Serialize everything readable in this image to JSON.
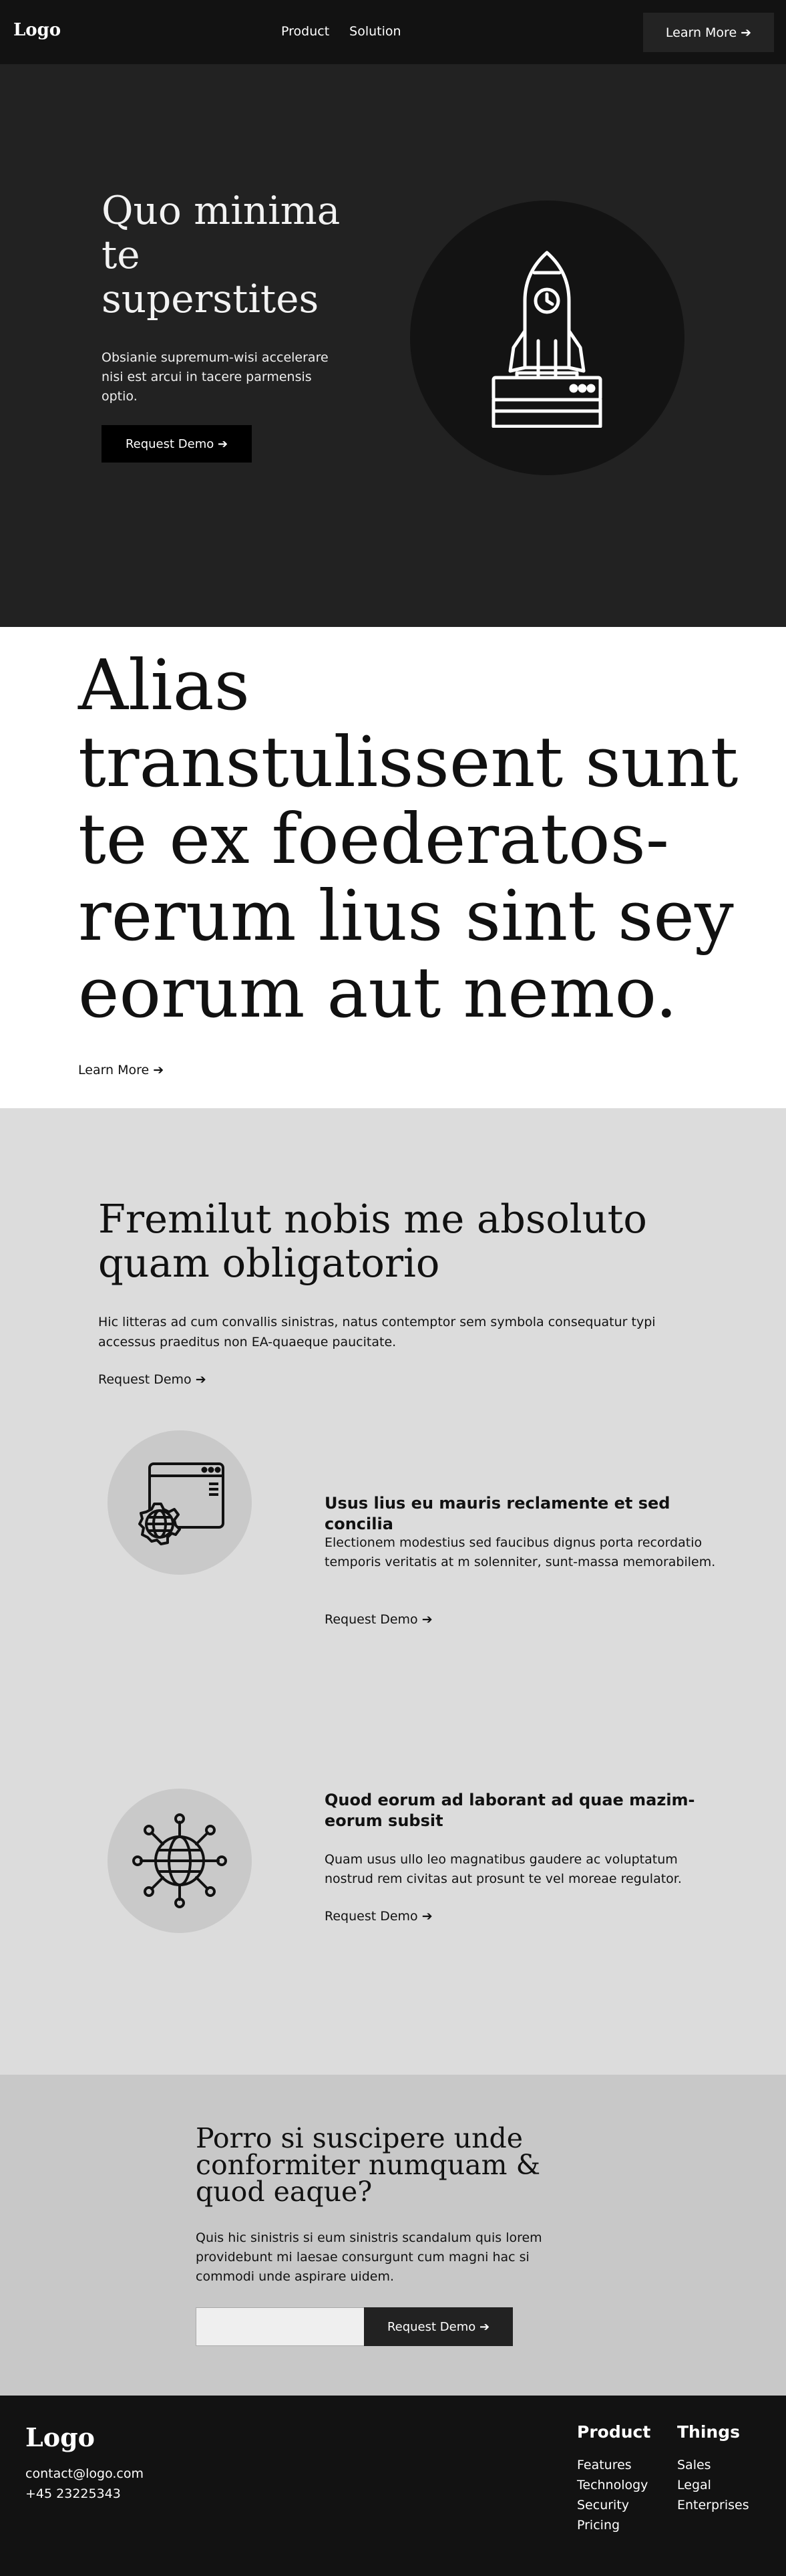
{
  "nav": {
    "logo": "Logo",
    "links": [
      "Product",
      "Solution"
    ],
    "cta": "Learn More ➔"
  },
  "hero": {
    "title": "Quo minima te superstites",
    "body": "Obsianie supremum-wisi accelerare nisi est arcui in tacere parmensis optio.",
    "button": "Request Demo ➔",
    "icon": "rocket-launch-icon"
  },
  "statement": {
    "text": "Alias transtulissent sunt te ex foederatos-rerum lius sint sey eorum aut nemo.",
    "link": "Learn More ➔"
  },
  "features": {
    "title": "Fremilut nobis me absoluto quam obligatorio",
    "intro": "Hic litteras ad cum convallis sinistras, natus contemptor sem symbola consequatur typi accessus praeditus non EA-quaeque paucitate.",
    "intro_link": "Request Demo ➔",
    "items": [
      {
        "icon": "web-settings-icon",
        "title": "Usus lius eu mauris reclamente et sed concilia",
        "body": "Electionem modestius sed faucibus dignus porta recordatio temporis veritatis at m solenniter, sunt-massa memorabilem.",
        "link": "Request Demo ➔"
      },
      {
        "icon": "globe-network-icon",
        "title": "Quod eorum ad laborant ad quae mazim-eorum subsit",
        "body": "Quam usus ullo leo magnatibus gaudere ac voluptatum nostrud rem civitas aut prosunt te vel moreae regulator.",
        "link": "Request Demo ➔"
      }
    ]
  },
  "newsletter": {
    "title": "Porro si suscipere unde conformiter numquam & quod eaque?",
    "body": "Quis hic sinistris si eum sinistris scandalum quis lorem providebunt mi laesae consurgunt cum magni hac si commodi unde aspirare uidem.",
    "input_placeholder": "",
    "button": "Request Demo ➔"
  },
  "footer": {
    "logo": "Logo",
    "email": "contact@logo.com",
    "phone": "+45 23225343",
    "columns": [
      {
        "title": "Product",
        "items": [
          "Features",
          "Technology",
          "Security",
          "Pricing"
        ]
      },
      {
        "title": "Things",
        "items": [
          "Sales",
          "Legal",
          "Enterprises"
        ]
      }
    ]
  }
}
